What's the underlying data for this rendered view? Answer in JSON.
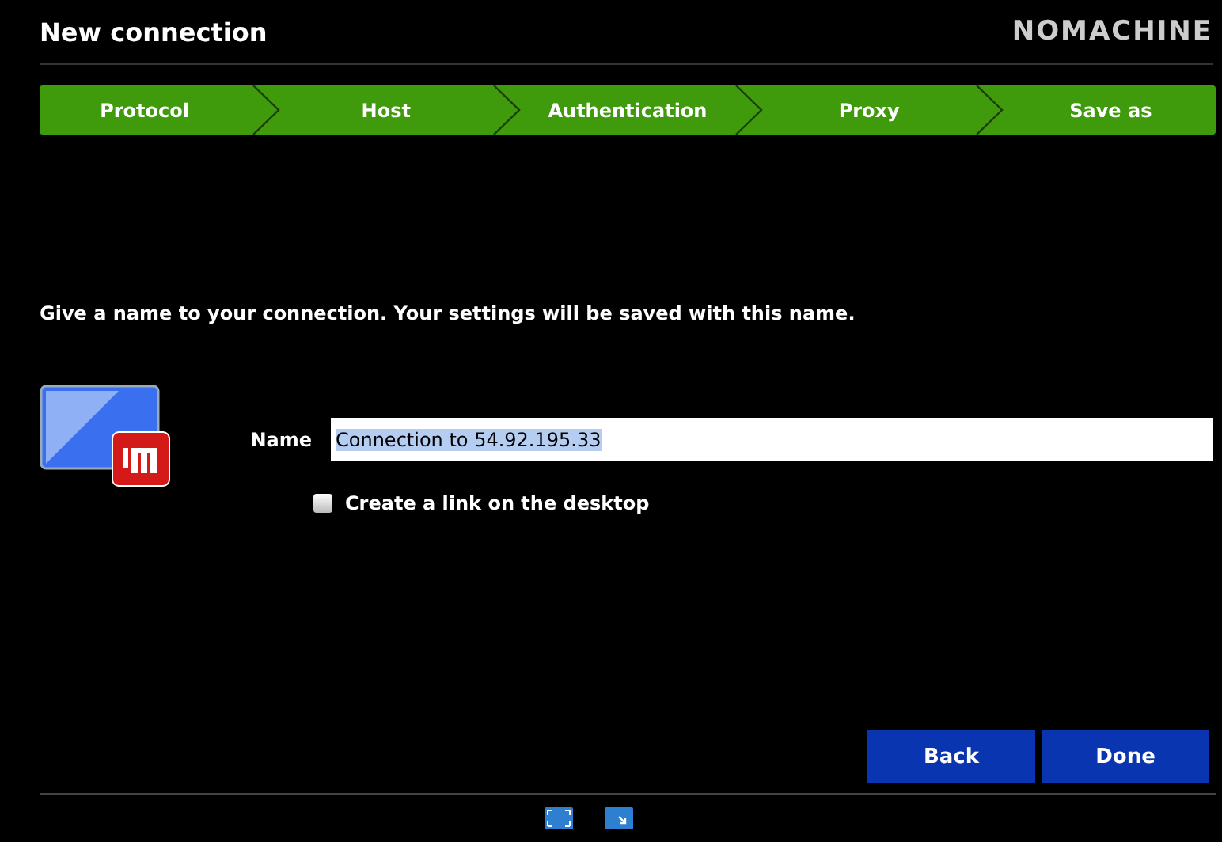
{
  "window": {
    "title": "New connection",
    "brand": "NOMACHINE"
  },
  "steps": [
    {
      "label": "Protocol"
    },
    {
      "label": "Host"
    },
    {
      "label": "Authentication"
    },
    {
      "label": "Proxy"
    },
    {
      "label": "Save as"
    }
  ],
  "instruction": "Give a name to your connection. Your settings will be saved with this name.",
  "name_field": {
    "label": "Name",
    "value": "Connection to 54.92.195.33",
    "text_selected": true
  },
  "desktop_link": {
    "label": "Create a link on the desktop",
    "checked": false
  },
  "buttons": [
    {
      "label": "Back"
    },
    {
      "label": "Done"
    }
  ]
}
